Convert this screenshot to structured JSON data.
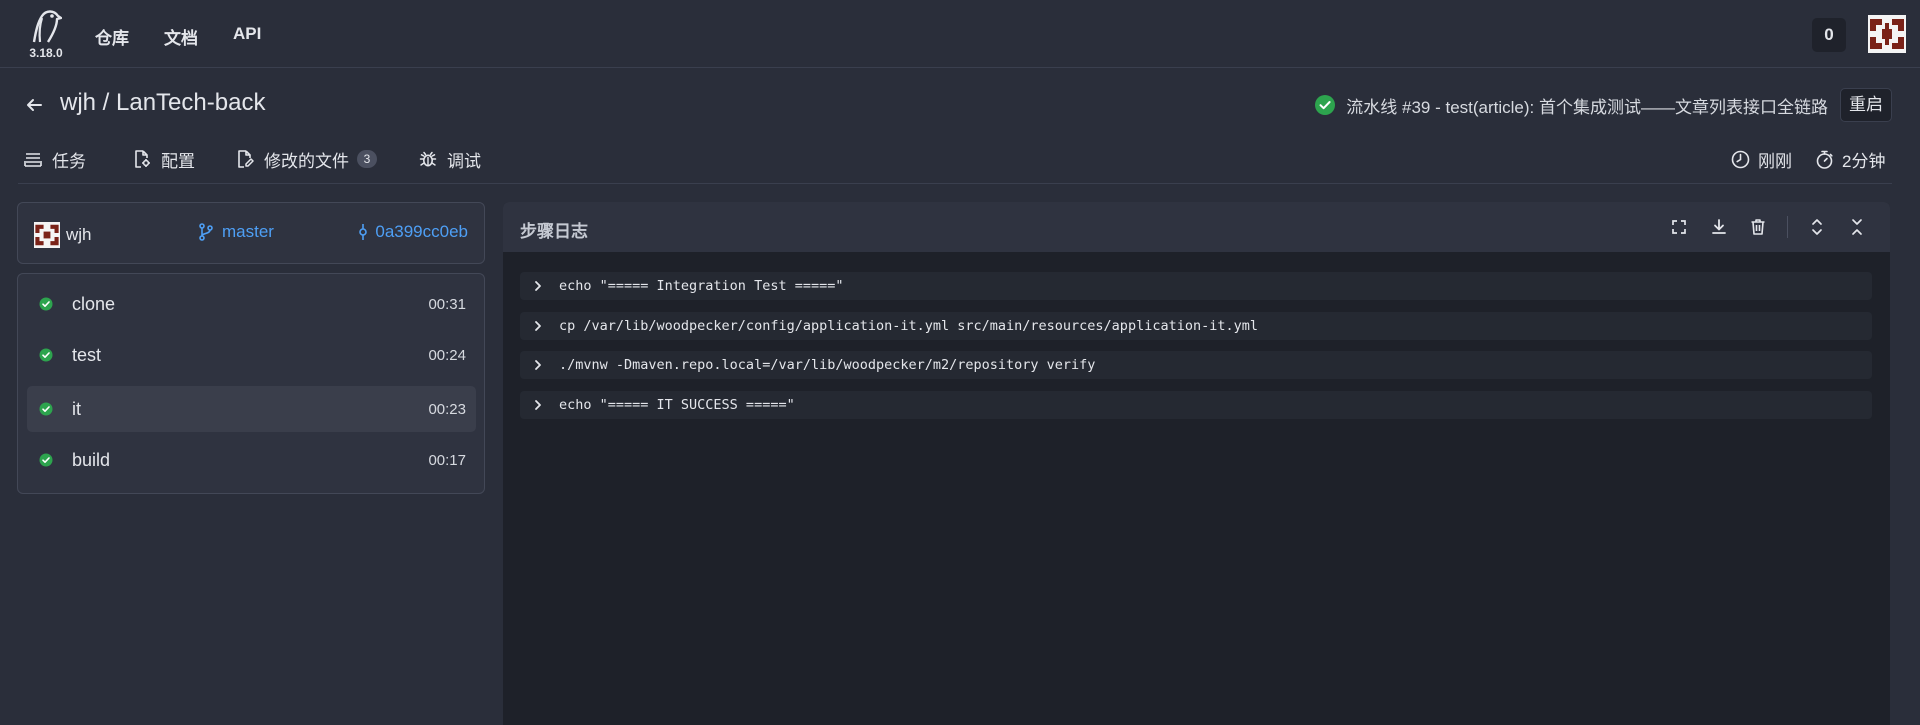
{
  "nav": {
    "version": "3.18.0",
    "links": [
      "仓库",
      "文档",
      "API"
    ],
    "notification_count": "0"
  },
  "header": {
    "repo_title": "wjh / LanTech-back",
    "pipeline_text": "流水线 #39  -  test(article): 首个集成测试——文章列表接口全链路",
    "restart_label": "重启",
    "tabs": [
      {
        "label": "任务",
        "icon": "list-icon"
      },
      {
        "label": "配置",
        "icon": "file-settings-icon"
      },
      {
        "label": "修改的文件",
        "icon": "file-edit-icon",
        "badge": "3"
      },
      {
        "label": "调试",
        "icon": "bug-icon"
      }
    ],
    "created": "刚刚",
    "duration": "2分钟"
  },
  "commit": {
    "author": "wjh",
    "branch": "master",
    "sha": "0a399cc0eb"
  },
  "steps": [
    {
      "name": "clone",
      "time": "00:31",
      "status": "success"
    },
    {
      "name": "test",
      "time": "00:24",
      "status": "success"
    },
    {
      "name": "it",
      "time": "00:23",
      "status": "success",
      "active": true
    },
    {
      "name": "build",
      "time": "00:17",
      "status": "success"
    }
  ],
  "log": {
    "title": "步骤日志",
    "actions": [
      "fullscreen-icon",
      "download-icon",
      "trash-icon",
      "expand-all-icon",
      "collapse-all-icon"
    ],
    "lines": [
      "echo \"===== Integration Test =====\"",
      "cp /var/lib/woodpecker/config/application-it.yml src/main/resources/application-it.yml",
      "./mvnw -Dmaven.repo.local=/var/lib/woodpecker/m2/repository verify",
      "echo \"===== IT SUCCESS =====\""
    ]
  },
  "colors": {
    "background": "#2a2e3a",
    "card": "#2f3340",
    "log_background": "#1e2129",
    "success": "#2da44e",
    "link": "#4e9ff5"
  }
}
